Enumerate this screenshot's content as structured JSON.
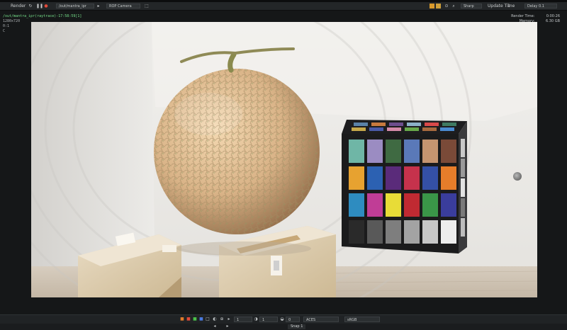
{
  "toolbar": {
    "render_label": "Render",
    "path_value": "/out/mantra_ipr",
    "camera_value": "ROP Camera",
    "sharp_value": "Sharp",
    "update_time_label": "Update Time",
    "update_time_value": "1",
    "delay_label": "Delay",
    "delay_value": "0.1"
  },
  "overlay": {
    "render_path": "/out/mantra_ipr(raytrace)-17:58:59[1]",
    "resolution": "1280x720",
    "line2": "0:1",
    "line3": "C",
    "render_time_label": "Render Time:",
    "render_time_value": "0:00:26",
    "memory_label": "Memory:",
    "memory_value": "6.30 GB"
  },
  "bottombar": {
    "frame_value": "1",
    "zoom_value": "1",
    "offset_value": "0",
    "colorspace_value": "ACES",
    "display_value": "sRGB"
  },
  "snapbar": {
    "snap_label": "Snap",
    "snap_value": "1"
  },
  "colors": {
    "toolbar_bg": "#232628",
    "overlay_path": "#76e08a",
    "accent_orange": "#d99a2b"
  },
  "checker": {
    "front": [
      [
        "#6fb6a6",
        "#9b8cc2",
        "#3f6a42",
        "#5a79b8",
        "#c59570",
        "#7a4a38"
      ],
      [
        "#e7a230",
        "#2c61b2",
        "#5a2b7a",
        "#c6324c",
        "#3450a6",
        "#e67d2a"
      ],
      [
        "#2e8cc0",
        "#c03d96",
        "#e8dc37",
        "#c02a32",
        "#3a9648",
        "#3a3d9c"
      ],
      [
        "#2a2a2a",
        "#595959",
        "#7e7e7e",
        "#a3a3a3",
        "#c7c7c7",
        "#ededed"
      ]
    ],
    "top": [
      "#5a82a8",
      "#c87a3e",
      "#6d4e8d",
      "#8cb0c8",
      "#d94a4a",
      "#3f7a62",
      "#c6a84a",
      "#4a5aa8",
      "#d58aa8",
      "#68a84a",
      "#a86a3e",
      "#4a8ad0"
    ]
  }
}
